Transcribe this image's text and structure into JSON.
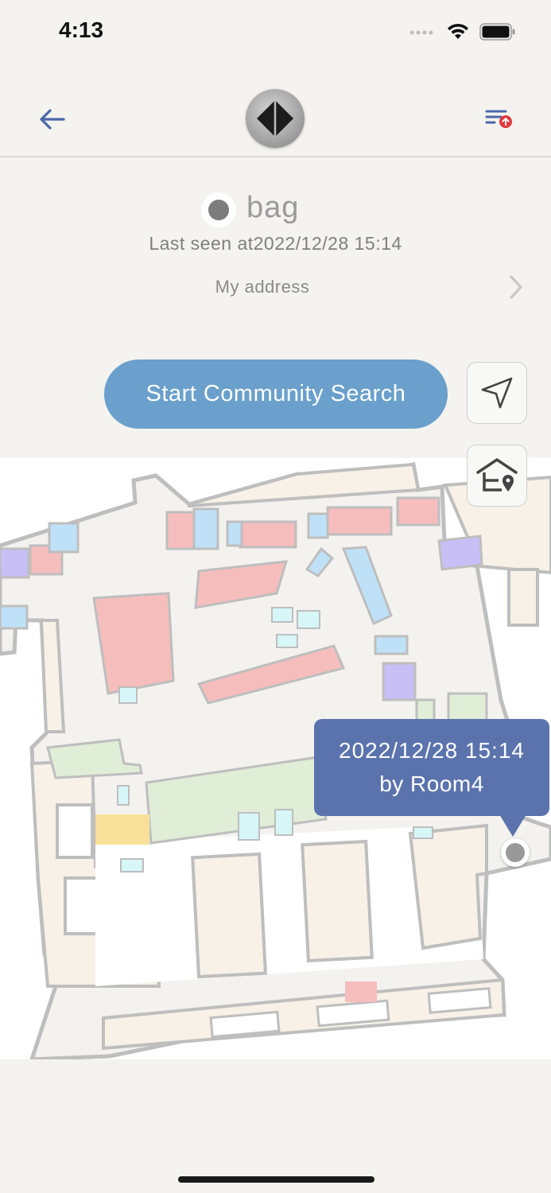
{
  "status_bar": {
    "time": "4:13"
  },
  "header": {
    "back_icon": "arrow-left-icon",
    "logo_icon": "app-logo",
    "filter_icon": "filter-alert-icon",
    "accent": "#4a68a8",
    "alert_color": "#e0383b"
  },
  "item": {
    "name": "bag",
    "last_seen": "Last seen at2022/12/28 15:14",
    "address_label": "My address"
  },
  "actions": {
    "community_search_label": "Start Community Search",
    "community_search_color": "#6aa0cb",
    "locate_icon": "navigation-arrow-icon",
    "home_icon": "home-location-icon"
  },
  "map": {
    "tooltip_time": "2022/12/28 15:14",
    "tooltip_by": "by Room4",
    "tooltip_color": "#5b73ad"
  }
}
